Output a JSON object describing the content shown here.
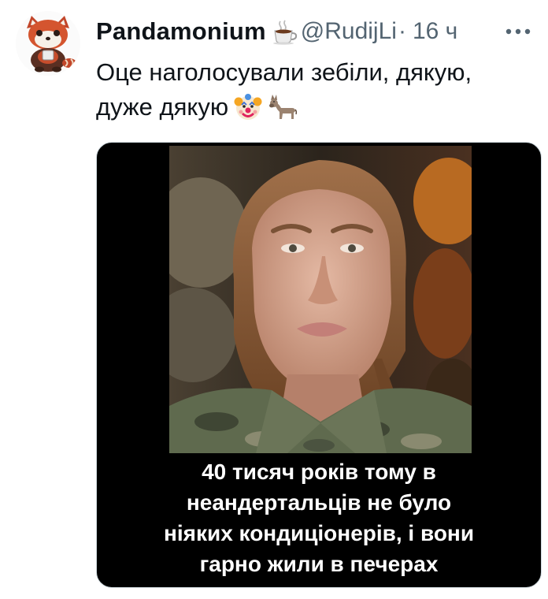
{
  "tweet": {
    "author": {
      "display_name": "Pandamonium",
      "name_emoji": "coffee-cup-emoji",
      "handle": "@RudijLi",
      "avatar": "red-panda-avatar"
    },
    "separator": "·",
    "timestamp": "16 ч",
    "more_icon": "more-dots-icon",
    "text_lines": [
      "Оце наголосували зебіли, дякую,",
      "дуже дякую"
    ],
    "text_emojis": [
      "clown-face-emoji",
      "donkey-emoji"
    ],
    "media": {
      "caption_lines": [
        "40 тисяч років тому в",
        "неандертальців не було",
        "ніяких кондиціонерів, і вони",
        "гарно жили в печерах"
      ]
    }
  },
  "colors": {
    "text_primary": "#0f1419",
    "text_secondary": "#536471",
    "media_background": "#000000",
    "caption_text": "#ffffff"
  }
}
